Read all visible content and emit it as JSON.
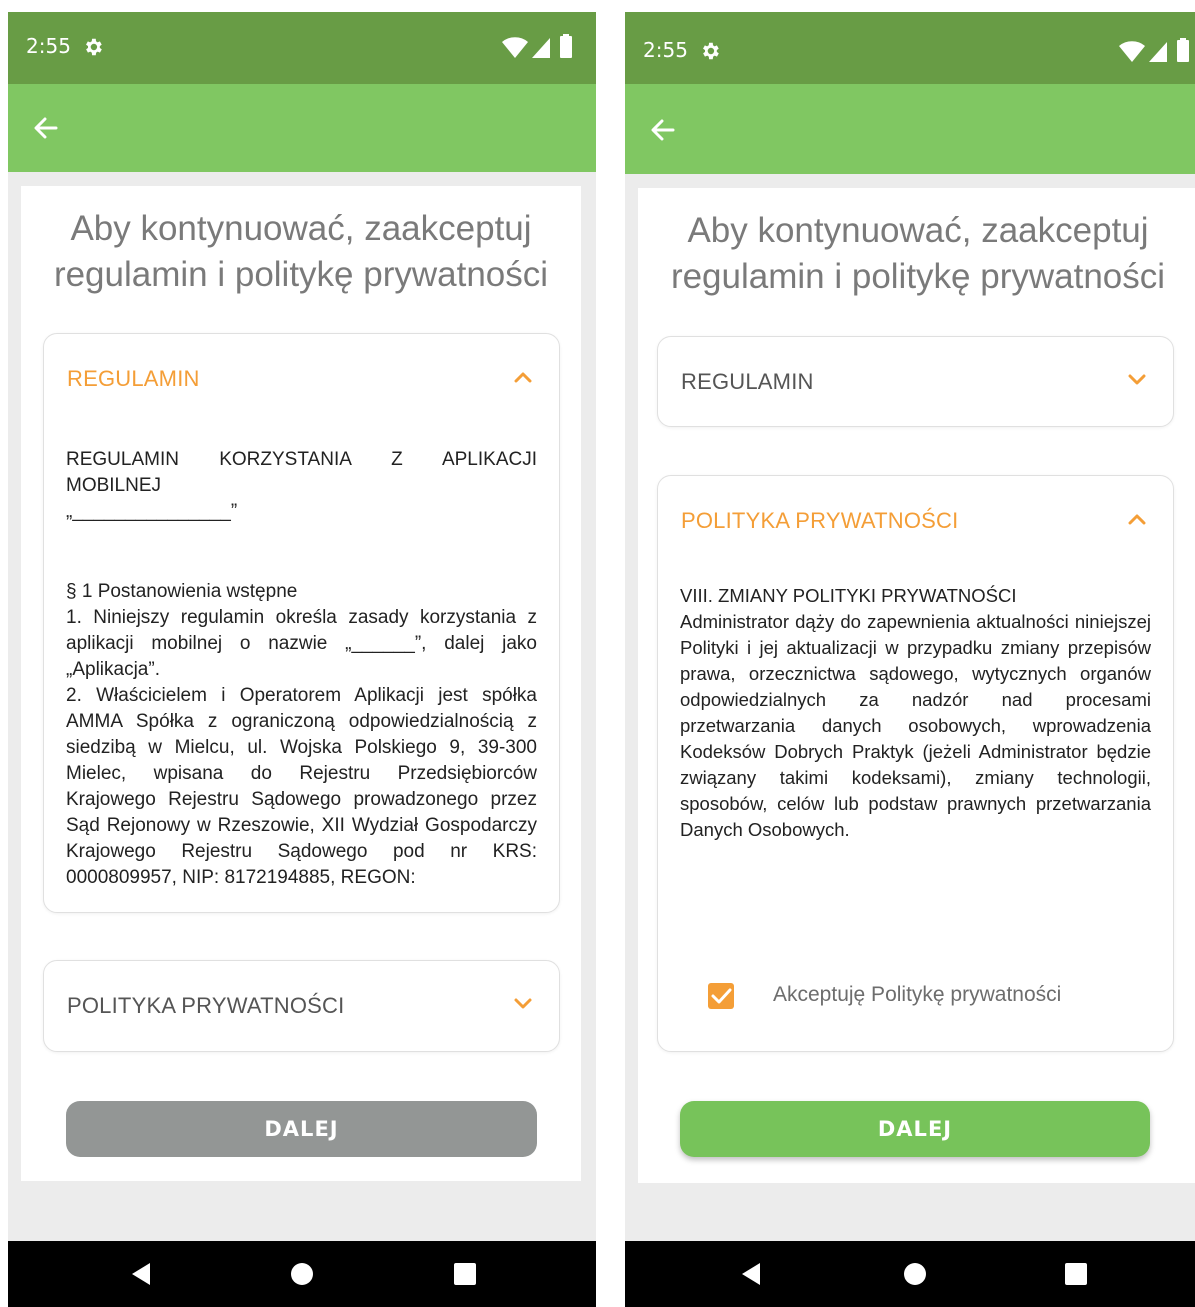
{
  "colors": {
    "statusbar": "#689c45",
    "appbar": "#80c762",
    "accent_orange": "#f49e37",
    "button_disabled": "#939695",
    "button_enabled": "#77c35a"
  },
  "left": {
    "status_time": "2:55",
    "title_line1": "Aby kontynuować, zaakceptuj",
    "title_line2": "regulamin i politykę prywatności",
    "regulamin_label": "REGULAMIN",
    "regulamin_text": {
      "heading_line1": "REGULAMIN KORZYSTANIA Z APLIKACJI",
      "heading_line2": "MOBILNEJ",
      "heading_line3": "„_______________”",
      "section_title": "§ 1 Postanowienia wstępne",
      "para1": "1. Niniejszy regulamin określa zasady korzystania z aplikacji mobilnej o nazwie „______”, dalej jako „Aplikacja”.",
      "para2": "2. Właścicielem i Operatorem Aplikacji jest spółka AMMA Spółka z ograniczoną odpowiedzialnością z siedzibą w Mielcu, ul. Wojska Polskiego 9, 39-300 Mielec, wpisana do Rejestru Przedsiębiorców Krajowego Rejestru Sądowego prowadzonego przez Sąd Rejonowy w Rzeszowie, XII Wydział Gospodarczy Krajowego Rejestru Sądowego pod nr KRS: 0000809957, NIP: 8172194885, REGON:"
    },
    "polityka_label": "POLITYKA PRYWATNOŚCI",
    "button_label": "DALEJ"
  },
  "right": {
    "status_time": "2:55",
    "title_line1": "Aby kontynuować, zaakceptuj",
    "title_line2": "regulamin i politykę prywatności",
    "regulamin_label": "REGULAMIN",
    "polityka_label": "POLITYKA PRYWATNOŚCI",
    "polityka_text": {
      "heading": "VIII. ZMIANY POLITYKI PRYWATNOŚCI",
      "body": "Administrator dąży do zapewnienia aktualności niniejszej Polityki i jej aktualizacji w przypadku zmiany przepisów prawa, orzecznictwa sądowego, wytycznych organów odpowiedzialnych za nadzór nad procesami przetwarzania danych osobowych, wprowadzenia Kodeksów Dobrych Praktyk (jeżeli Administrator będzie związany takimi kodeksami), zmiany technologii, sposobów, celów lub podstaw prawnych przetwarzania Danych Osobowych."
    },
    "checkbox_label": "Akceptuję Politykę prywatności",
    "checkbox_checked": true,
    "button_label": "DALEJ"
  },
  "icons": {
    "gear": "gear-icon",
    "wifi": "wifi-icon",
    "signal": "signal-icon",
    "battery": "battery-icon",
    "back": "back-arrow-icon",
    "chevron_up": "chevron-up-icon",
    "chevron_down": "chevron-down-icon",
    "check": "check-icon",
    "nav_back": "nav-back-icon",
    "nav_home": "nav-home-icon",
    "nav_recents": "nav-recents-icon"
  }
}
